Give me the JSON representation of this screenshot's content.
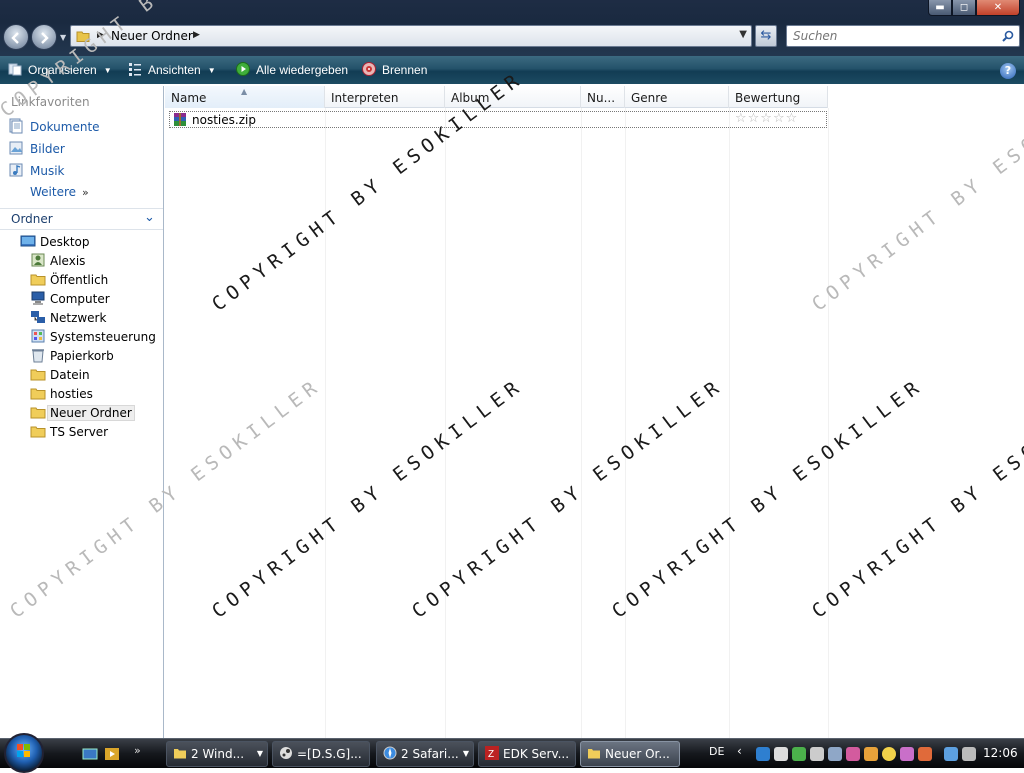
{
  "window": {
    "controls": {
      "minimize": "▬",
      "maximize": "◻",
      "close": "✕"
    }
  },
  "addressbar": {
    "path": "Neuer Ordner",
    "search_placeholder": "Suchen"
  },
  "commandbar": {
    "organize": "Organisieren",
    "views": "Ansichten",
    "play_all": "Alle wiedergeben",
    "burn": "Brennen",
    "help": "?"
  },
  "favorites": {
    "title": "Linkfavoriten",
    "items": [
      {
        "label": "Dokumente",
        "icon": "documents-icon"
      },
      {
        "label": "Bilder",
        "icon": "pictures-icon"
      },
      {
        "label": "Musik",
        "icon": "music-icon"
      }
    ],
    "more": "Weitere",
    "more_chevron": "»"
  },
  "folders": {
    "title": "Ordner",
    "tree": [
      {
        "label": "Desktop",
        "icon": "desktop-icon",
        "level": 0
      },
      {
        "label": "Alexis",
        "icon": "user-folder-icon",
        "level": 1
      },
      {
        "label": "Öffentlich",
        "icon": "folder-icon",
        "level": 1
      },
      {
        "label": "Computer",
        "icon": "computer-icon",
        "level": 1
      },
      {
        "label": "Netzwerk",
        "icon": "network-icon",
        "level": 1
      },
      {
        "label": "Systemsteuerung",
        "icon": "control-panel-icon",
        "level": 1
      },
      {
        "label": "Papierkorb",
        "icon": "recycle-bin-icon",
        "level": 1
      },
      {
        "label": "Datein",
        "icon": "folder-icon",
        "level": 1
      },
      {
        "label": "hosties",
        "icon": "folder-icon",
        "level": 1
      },
      {
        "label": "Neuer Ordner",
        "icon": "folder-icon",
        "level": 1,
        "selected": true
      },
      {
        "label": "TS Server",
        "icon": "folder-icon",
        "level": 1
      }
    ]
  },
  "columns": [
    "Name",
    "Interpreten",
    "Album",
    "Nu...",
    "Genre",
    "Bewertung"
  ],
  "files": [
    {
      "name": "nosties.zip",
      "icon": "winrar-archive-icon",
      "rating": 0,
      "rating_max": 5
    }
  ],
  "watermark": "COPYRIGHT BY ESOKILLER",
  "taskbar": {
    "tasks": [
      {
        "label": "2 Wind...",
        "icon": "explorer-icon"
      },
      {
        "label": "=[D.S.G]...",
        "icon": "steam-icon"
      },
      {
        "label": "2 Safari...",
        "icon": "safari-icon"
      },
      {
        "label": "EDK Serv...",
        "icon": "filezilla-icon"
      },
      {
        "label": "Neuer Or...",
        "icon": "folder-icon",
        "active": true
      }
    ],
    "language": "DE",
    "clock": "12:06"
  }
}
